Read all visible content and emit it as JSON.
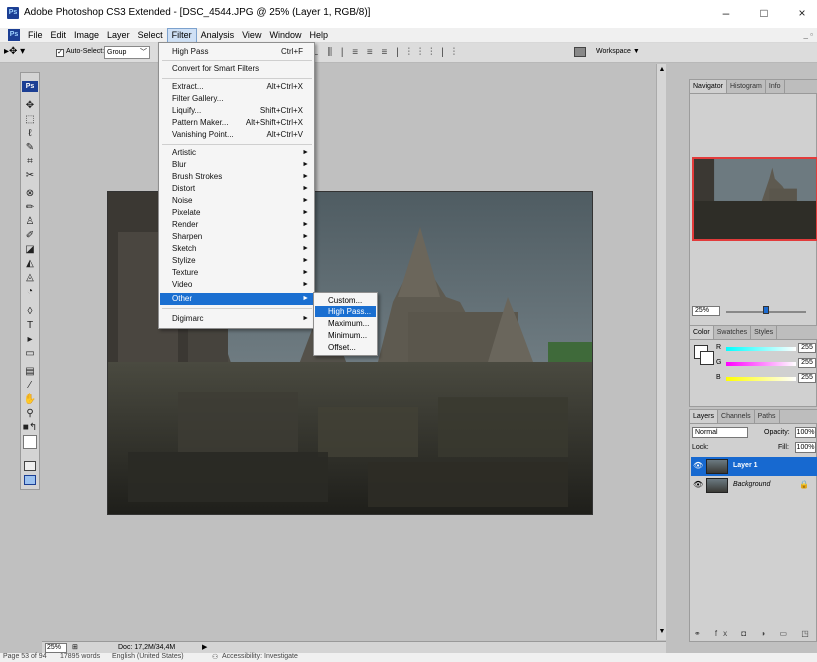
{
  "window": {
    "title": "Adobe Photoshop CS3 Extended - [DSC_4544.JPG @ 25% (Layer 1, RGB/8)]",
    "minimize": "–",
    "maximize": "□",
    "close": "×"
  },
  "menubar": {
    "items": [
      "File",
      "Edit",
      "Image",
      "Layer",
      "Select",
      "Filter",
      "Analysis",
      "View",
      "Window",
      "Help"
    ],
    "active": "Filter"
  },
  "options": {
    "auto_select_label": "Auto-Select:",
    "auto_select_value": "Group",
    "workspace_label": "Workspace ▼"
  },
  "filter_menu": {
    "items": [
      {
        "label": "High Pass",
        "shortcut": "Ctrl+F"
      },
      {
        "label": "Convert for Smart Filters"
      },
      {
        "label": "Extract...",
        "shortcut": "Alt+Ctrl+X"
      },
      {
        "label": "Filter Gallery..."
      },
      {
        "label": "Liquify...",
        "shortcut": "Shift+Ctrl+X"
      },
      {
        "label": "Pattern Maker...",
        "shortcut": "Alt+Shift+Ctrl+X"
      },
      {
        "label": "Vanishing Point...",
        "shortcut": "Alt+Ctrl+V"
      },
      {
        "label": "Artistic"
      },
      {
        "label": "Blur"
      },
      {
        "label": "Brush Strokes"
      },
      {
        "label": "Distort"
      },
      {
        "label": "Noise"
      },
      {
        "label": "Pixelate"
      },
      {
        "label": "Render"
      },
      {
        "label": "Sharpen"
      },
      {
        "label": "Sketch"
      },
      {
        "label": "Stylize"
      },
      {
        "label": "Texture"
      },
      {
        "label": "Video"
      },
      {
        "label": "Other"
      },
      {
        "label": "Digimarc"
      }
    ]
  },
  "other_submenu": {
    "items": [
      "Custom...",
      "High Pass...",
      "Maximum...",
      "Minimum...",
      "Offset..."
    ]
  },
  "navigator": {
    "tabs": [
      "Navigator",
      "Histogram",
      "Info"
    ],
    "zoom": "25%"
  },
  "color_panel": {
    "tabs": [
      "Color",
      "Swatches",
      "Styles"
    ],
    "channels": [
      {
        "label": "R",
        "value": "255"
      },
      {
        "label": "G",
        "value": "255"
      },
      {
        "label": "B",
        "value": "255"
      }
    ]
  },
  "layers_panel": {
    "tabs": [
      "Layers",
      "Channels",
      "Paths"
    ],
    "blend_mode": "Normal",
    "opacity_label": "Opacity:",
    "opacity": "100%",
    "lock_label": "Lock:",
    "fill_label": "Fill:",
    "fill": "100%",
    "layers": [
      {
        "name": "Layer 1",
        "selected": true
      },
      {
        "name": "Background",
        "selected": false
      }
    ]
  },
  "ps_status": {
    "zoom": "25%",
    "doc": "Doc: 17,2M/34,4M"
  },
  "word_status": {
    "page": "Page 53 of 94",
    "words": "17895 words",
    "language": "English (United States)",
    "accessibility": "Accessibility: Investigate"
  },
  "colors": {
    "menu_highlight": "#1a6fd1",
    "layer_selected": "#1769d0",
    "nav_view_box": "#e23b3b"
  }
}
